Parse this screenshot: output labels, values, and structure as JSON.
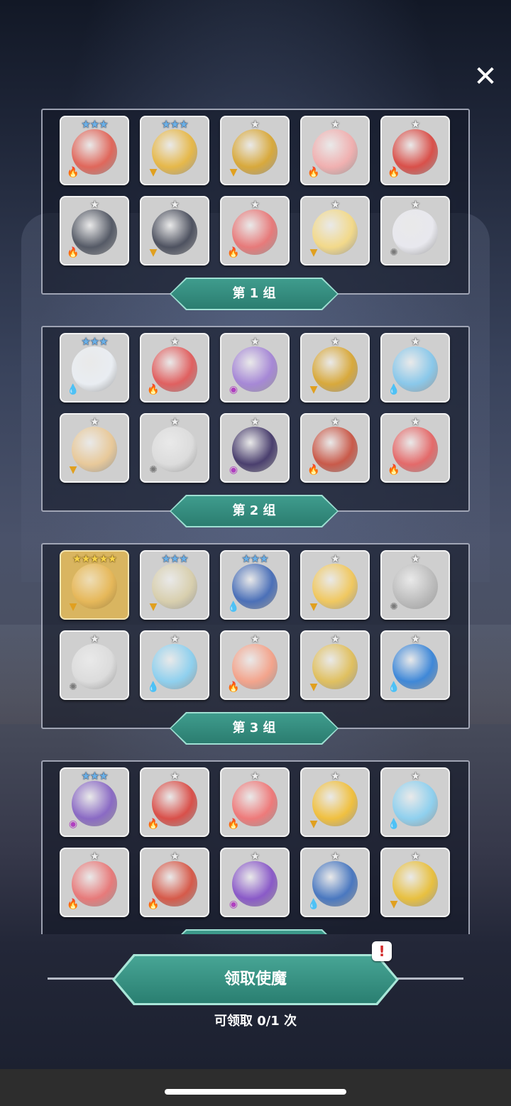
{
  "close_icon": "✕",
  "groups": [
    {
      "label": "第 1 组",
      "cards": [
        {
          "stars": "★★★",
          "star_color": "blue",
          "element": "fire",
          "portrait": "#e0675b"
        },
        {
          "stars": "★★★",
          "star_color": "blue",
          "element": "earth",
          "portrait": "#e6b84a"
        },
        {
          "stars": "★",
          "star_color": "grey",
          "element": "earth",
          "portrait": "#d8a93c"
        },
        {
          "stars": "★",
          "star_color": "grey",
          "element": "fire",
          "portrait": "#f0b0b0"
        },
        {
          "stars": "★",
          "star_color": "grey",
          "element": "fire",
          "portrait": "#d9504a"
        },
        {
          "stars": "★",
          "star_color": "grey",
          "element": "fire",
          "portrait": "#555a66"
        },
        {
          "stars": "★",
          "star_color": "grey",
          "element": "earth",
          "portrait": "#4e5260"
        },
        {
          "stars": "★",
          "star_color": "grey",
          "element": "fire",
          "portrait": "#e77a7a"
        },
        {
          "stars": "★",
          "star_color": "grey",
          "element": "earth",
          "portrait": "#f2d98a"
        },
        {
          "stars": "★",
          "star_color": "grey",
          "element": "light",
          "portrait": "#e8e8ee"
        }
      ]
    },
    {
      "label": "第 2 组",
      "cards": [
        {
          "stars": "★★★",
          "star_color": "blue",
          "element": "water",
          "portrait": "#e9edf2"
        },
        {
          "stars": "★",
          "star_color": "grey",
          "element": "fire",
          "portrait": "#e06060"
        },
        {
          "stars": "★",
          "star_color": "grey",
          "element": "dark",
          "portrait": "#a688d6"
        },
        {
          "stars": "★",
          "star_color": "grey",
          "element": "earth",
          "portrait": "#d8a93c"
        },
        {
          "stars": "★",
          "star_color": "grey",
          "element": "water",
          "portrait": "#8ac8ea"
        },
        {
          "stars": "★",
          "star_color": "grey",
          "element": "earth",
          "portrait": "#e8c99a"
        },
        {
          "stars": "★",
          "star_color": "grey",
          "element": "light",
          "portrait": "#dcdcdc"
        },
        {
          "stars": "★",
          "star_color": "grey",
          "element": "dark",
          "portrait": "#4a3f6e"
        },
        {
          "stars": "★",
          "star_color": "grey",
          "element": "fire",
          "portrait": "#c95a4a"
        },
        {
          "stars": "★",
          "star_color": "grey",
          "element": "fire",
          "portrait": "#e46a6a"
        }
      ]
    },
    {
      "label": "第 3 组",
      "cards": [
        {
          "stars": "★★★★★",
          "star_color": "gold",
          "element": "earth",
          "portrait": "#e6b85a",
          "rare": true
        },
        {
          "stars": "★★★",
          "star_color": "blue",
          "element": "earth",
          "portrait": "#d8cfae"
        },
        {
          "stars": "★★★",
          "star_color": "blue",
          "element": "water",
          "portrait": "#4b70b8"
        },
        {
          "stars": "★",
          "star_color": "grey",
          "element": "earth",
          "portrait": "#f0c860"
        },
        {
          "stars": "★",
          "star_color": "grey",
          "element": "light",
          "portrait": "#bdbdbd"
        },
        {
          "stars": "★",
          "star_color": "grey",
          "element": "light",
          "portrait": "#dcdcdc"
        },
        {
          "stars": "★",
          "star_color": "grey",
          "element": "water",
          "portrait": "#8fd0ee"
        },
        {
          "stars": "★",
          "star_color": "grey",
          "element": "fire",
          "portrait": "#f3a48c"
        },
        {
          "stars": "★",
          "star_color": "grey",
          "element": "earth",
          "portrait": "#e0c060"
        },
        {
          "stars": "★",
          "star_color": "grey",
          "element": "water",
          "portrait": "#3f88d8"
        }
      ]
    },
    {
      "label": "",
      "cards": [
        {
          "stars": "★★★",
          "star_color": "blue",
          "element": "dark",
          "portrait": "#8a6ac4"
        },
        {
          "stars": "★",
          "star_color": "grey",
          "element": "fire",
          "portrait": "#d9504a"
        },
        {
          "stars": "★",
          "star_color": "grey",
          "element": "fire",
          "portrait": "#ee7a7a"
        },
        {
          "stars": "★",
          "star_color": "grey",
          "element": "earth",
          "portrait": "#f0c040"
        },
        {
          "stars": "★",
          "star_color": "grey",
          "element": "water",
          "portrait": "#8fd0ee"
        },
        {
          "stars": "★",
          "star_color": "grey",
          "element": "fire",
          "portrait": "#e77a7a"
        },
        {
          "stars": "★",
          "star_color": "grey",
          "element": "fire",
          "portrait": "#d65a4a"
        },
        {
          "stars": "★",
          "star_color": "grey",
          "element": "dark",
          "portrait": "#8a5ac8"
        },
        {
          "stars": "★",
          "star_color": "grey",
          "element": "water",
          "portrait": "#4a78c0"
        },
        {
          "stars": "★",
          "star_color": "grey",
          "element": "earth",
          "portrait": "#e8c040"
        }
      ]
    }
  ],
  "element_icons": {
    "fire": "🔥",
    "water": "💧",
    "earth": "▼",
    "light": "✺",
    "dark": "◉"
  },
  "element_colors": {
    "fire": "#e04a2a",
    "water": "#3a8ee0",
    "earth": "#e0a020",
    "light": "#7a7a7a",
    "dark": "#b040c0"
  },
  "claim_button": "领取使魔",
  "alert_icon": "!",
  "claim_count": "可领取 0/1 次"
}
